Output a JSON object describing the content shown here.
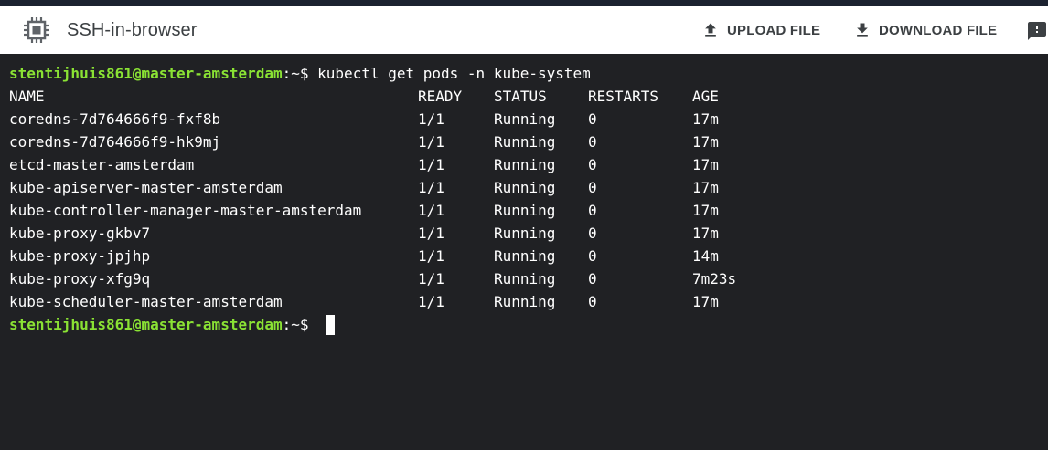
{
  "header": {
    "title": "SSH-in-browser",
    "upload_label": "UPLOAD FILE",
    "download_label": "DOWNLOAD FILE",
    "icons": {
      "app": "chip-icon",
      "upload": "upload-icon",
      "download": "download-icon",
      "feedback": "feedback-icon"
    }
  },
  "terminal": {
    "prompt_user": "stentijhuis861@master-amsterdam",
    "prompt_path": ":~$ ",
    "command": "kubectl get pods -n kube-system",
    "columns": {
      "name": "NAME",
      "ready": "READY",
      "status": "STATUS",
      "restarts": "RESTARTS",
      "age": "AGE"
    },
    "rows": [
      {
        "name": "coredns-7d764666f9-fxf8b",
        "ready": "1/1",
        "status": "Running",
        "restarts": "0",
        "age": "17m"
      },
      {
        "name": "coredns-7d764666f9-hk9mj",
        "ready": "1/1",
        "status": "Running",
        "restarts": "0",
        "age": "17m"
      },
      {
        "name": "etcd-master-amsterdam",
        "ready": "1/1",
        "status": "Running",
        "restarts": "0",
        "age": "17m"
      },
      {
        "name": "kube-apiserver-master-amsterdam",
        "ready": "1/1",
        "status": "Running",
        "restarts": "0",
        "age": "17m"
      },
      {
        "name": "kube-controller-manager-master-amsterdam",
        "ready": "1/1",
        "status": "Running",
        "restarts": "0",
        "age": "17m"
      },
      {
        "name": "kube-proxy-gkbv7",
        "ready": "1/1",
        "status": "Running",
        "restarts": "0",
        "age": "17m"
      },
      {
        "name": "kube-proxy-jpjhp",
        "ready": "1/1",
        "status": "Running",
        "restarts": "0",
        "age": "14m"
      },
      {
        "name": "kube-proxy-xfg9q",
        "ready": "1/1",
        "status": "Running",
        "restarts": "0",
        "age": "7m23s"
      },
      {
        "name": "kube-scheduler-master-amsterdam",
        "ready": "1/1",
        "status": "Running",
        "restarts": "0",
        "age": "17m"
      }
    ]
  },
  "colors": {
    "prompt_green": "#8ae234",
    "terminal_bg": "#202124",
    "header_bg": "#ffffff"
  }
}
